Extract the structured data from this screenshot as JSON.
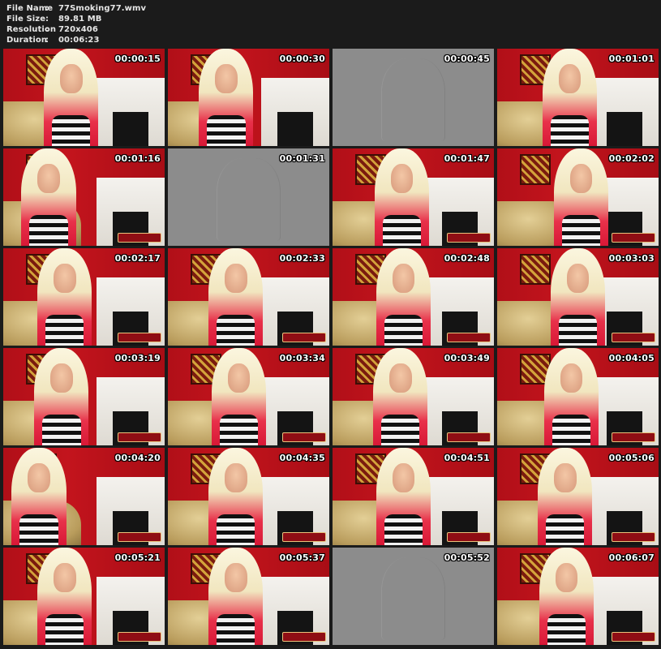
{
  "info": {
    "file_name_label": "File Name",
    "file_name_value": "77Smoking77.wmv",
    "file_size_label": "File Size",
    "file_size_value": "89.81 MB",
    "resolution_label": "Resolution",
    "resolution_value": "720x406",
    "duration_label": "Duration",
    "duration_value": "00:06:23",
    "separator": ":"
  },
  "thumbnails": [
    {
      "timestamp": "00:00:15",
      "type": "scene"
    },
    {
      "timestamp": "00:00:30",
      "type": "scene"
    },
    {
      "timestamp": "00:00:45",
      "type": "blank"
    },
    {
      "timestamp": "00:01:01",
      "type": "scene"
    },
    {
      "timestamp": "00:01:16",
      "type": "scene"
    },
    {
      "timestamp": "00:01:31",
      "type": "blank"
    },
    {
      "timestamp": "00:01:47",
      "type": "scene"
    },
    {
      "timestamp": "00:02:02",
      "type": "scene"
    },
    {
      "timestamp": "00:02:17",
      "type": "scene"
    },
    {
      "timestamp": "00:02:33",
      "type": "scene"
    },
    {
      "timestamp": "00:02:48",
      "type": "scene"
    },
    {
      "timestamp": "00:03:03",
      "type": "scene"
    },
    {
      "timestamp": "00:03:19",
      "type": "scene"
    },
    {
      "timestamp": "00:03:34",
      "type": "scene"
    },
    {
      "timestamp": "00:03:49",
      "type": "scene"
    },
    {
      "timestamp": "00:04:05",
      "type": "scene"
    },
    {
      "timestamp": "00:04:20",
      "type": "scene"
    },
    {
      "timestamp": "00:04:35",
      "type": "scene"
    },
    {
      "timestamp": "00:04:51",
      "type": "scene"
    },
    {
      "timestamp": "00:05:06",
      "type": "scene"
    },
    {
      "timestamp": "00:05:21",
      "type": "scene"
    },
    {
      "timestamp": "00:05:37",
      "type": "scene"
    },
    {
      "timestamp": "00:05:52",
      "type": "blank"
    },
    {
      "timestamp": "00:06:07",
      "type": "scene"
    }
  ],
  "colors": {
    "background": "#1b1b1b",
    "wall_red": "#c3141d",
    "blank_frame": "#8c8c8c"
  }
}
